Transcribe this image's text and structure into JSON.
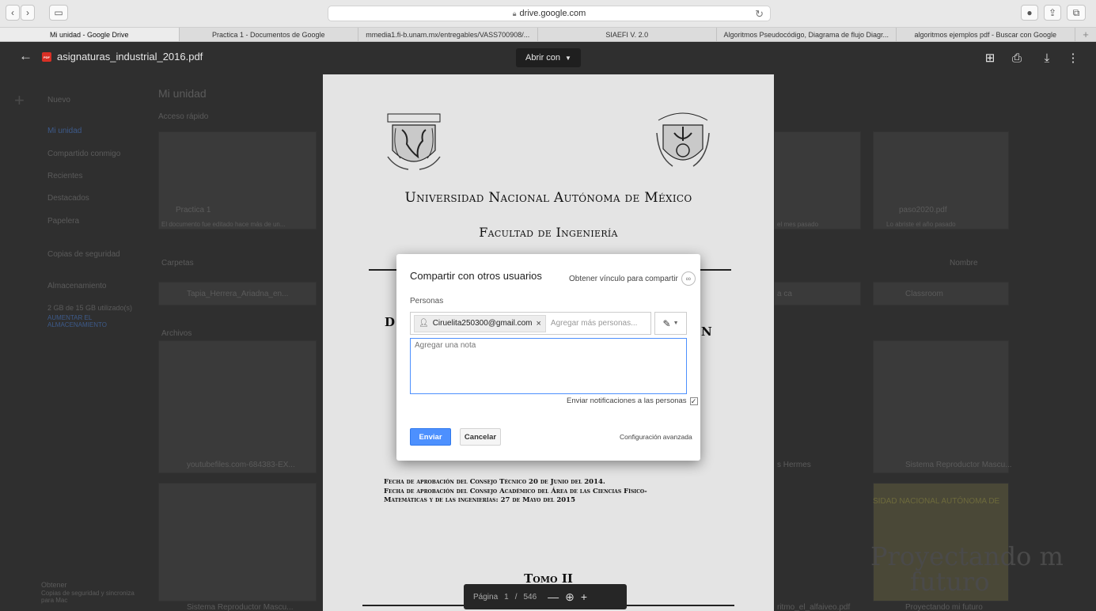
{
  "browser": {
    "url": "drive.google.com",
    "tabs": [
      {
        "label": "Mi unidad - Google Drive",
        "active": true
      },
      {
        "label": "Practica 1 - Documentos de Google",
        "active": false
      },
      {
        "label": "mmedia1.fi-b.unam.mx/entregables/VASS700908/...",
        "active": false
      },
      {
        "label": "SIAEFI V. 2.0",
        "active": false
      },
      {
        "label": "Algoritmos Pseudocódigo, Diagrama de flujo Diagr...",
        "active": false
      },
      {
        "label": "algoritmos ejemplos pdf - Buscar con Google",
        "active": false
      }
    ]
  },
  "viewer": {
    "file_name": "asignaturas_industrial_2016.pdf",
    "open_with": "Abrir con",
    "page_label": "Página",
    "page_current": "1",
    "page_sep": "/",
    "page_total": "546"
  },
  "drive_bg": {
    "new_label": "Nuevo",
    "title": "Mi unidad",
    "quick_access": "Acceso rápido",
    "sidebar": [
      "Mi unidad",
      "Compartido conmigo",
      "Recientes",
      "Destacados",
      "Papelera",
      "Copias de seguridad",
      "Almacenamiento"
    ],
    "storage_used": "2 GB de 15 GB utilizado(s)",
    "storage_upgrade": "AUMENTAR EL ALMACENAMIENTO",
    "folders_label": "Carpetas",
    "files_label": "Archivos",
    "sort_label": "Nombre",
    "folder_name": "Tapia_Herrera_Ariadna_en...",
    "folder_right_partial": "a ca",
    "folder_right": "Classroom",
    "quick_cards": [
      {
        "name": "Practica 1",
        "sub": "El documento fue editado hace más de un..."
      },
      {
        "name": "paso2020.pdf",
        "sub": "Lo abriste el año pasado"
      }
    ],
    "file_cards": [
      {
        "name": "youtubefiles.com-684383-EX..."
      },
      {
        "name": "Sistema Reproductor Mascu..."
      },
      {
        "name": "Sistema Reproductor Mascu..."
      },
      {
        "name": "Proyectando mi futuro"
      }
    ],
    "backup_title": "Obtener",
    "backup_sub": "Copias de seguridad y sincroniza para Mac",
    "promo_line1": "SIDAD NACIONAL AUTÓNOMA DE",
    "promo_big1": "Proyectando m",
    "promo_big2": "futuro",
    "partial_hermes": "s Hermes",
    "partial_algo": "ritmo_el_alfaiveo.pdf",
    "partial_vezes": "el mes pasado"
  },
  "pdf": {
    "left_seal_text": "UNIVERSIDAD NACIONAL AUTÓNOMA DE MÉXICO",
    "right_seal_text": "INGENIERIA",
    "university": "Universidad Nacional Autónoma de México",
    "faculty": "Facultad de Ingeniería",
    "hidden_left": "D",
    "hidden_right": "N",
    "note1": "Fecha de aprobación del Consejo Técnico 20 de Junio del 2014.",
    "note2": "Fecha de aprobación del Consejo Académico del Área de las Ciencias Físico-",
    "note3": "Matemáticas y de las ingenierías: 27 de Mayo del 2015",
    "tomo": "Tomo II"
  },
  "share_dialog": {
    "title": "Compartir con otros usuarios",
    "get_link": "Obtener vínculo para compartir",
    "people_label": "Personas",
    "recipient": "Ciruelita250300@gmail.com",
    "add_more_placeholder": "Agregar más personas...",
    "note_placeholder": "Agregar una nota",
    "notify_label": "Enviar notificaciones a las personas",
    "notify_checked": true,
    "send_label": "Enviar",
    "cancel_label": "Cancelar",
    "advanced_label": "Configuración avanzada",
    "accent_color": "#4d90fe"
  },
  "icons": [
    "back-arrow-icon",
    "pdf-icon",
    "add-to-drive-icon",
    "print-icon",
    "download-icon",
    "more-vert-icon",
    "person-icon",
    "link-icon",
    "pencil-icon",
    "zoom-in-icon"
  ]
}
